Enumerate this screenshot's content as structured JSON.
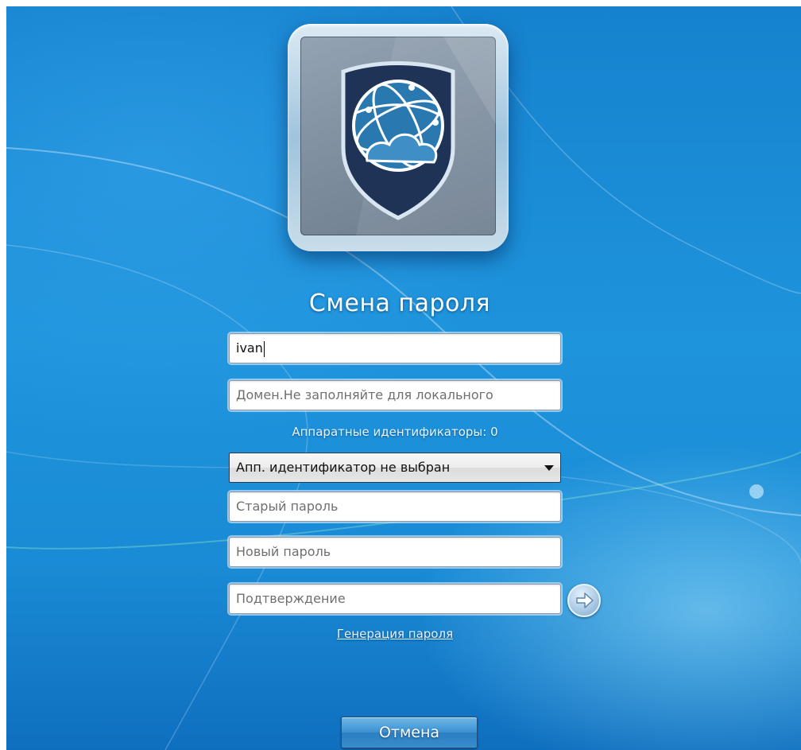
{
  "logo": {
    "icon": "shield-globe-cloud-icon",
    "colors": {
      "shield": "#1f3356",
      "globe": "#2a78b0",
      "cloud": "#3f8fc6"
    }
  },
  "title": "Смена пароля",
  "fields": {
    "username": {
      "value": "ivan"
    },
    "domain": {
      "placeholder": "Домен.Не заполняйте для локального"
    },
    "hardware_ids_label": "Аппаратные идентификаторы: 0",
    "hardware_id_select": {
      "selected": "Апп. идентификатор не выбран"
    },
    "old_password": {
      "placeholder": "Старый пароль"
    },
    "new_password": {
      "placeholder": "Новый пароль"
    },
    "confirm_password": {
      "placeholder": "Подтверждение"
    }
  },
  "submit": {
    "icon": "arrow-right-icon"
  },
  "generate_password_link": "Генерация пароля",
  "cancel_button": "Отмена",
  "theme": {
    "background": "#1a8bd6",
    "text": "#ffffff"
  }
}
